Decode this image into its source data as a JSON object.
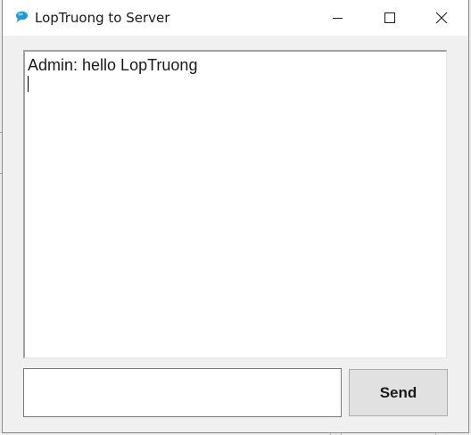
{
  "window": {
    "title": "LopTruong to Server",
    "icon": "chat-bubble-icon",
    "controls": {
      "minimize": "minimize-icon",
      "maximize": "maximize-icon",
      "close": "close-icon"
    }
  },
  "chat": {
    "messages": [
      "Admin: hello LopTruong"
    ]
  },
  "compose": {
    "input_value": "",
    "send_label": "Send"
  },
  "colors": {
    "window_bg": "#f0f0f0",
    "titlebar_bg": "#ffffff",
    "button_bg": "#e1e1e1",
    "icon_accent": "#1e9bd7"
  }
}
